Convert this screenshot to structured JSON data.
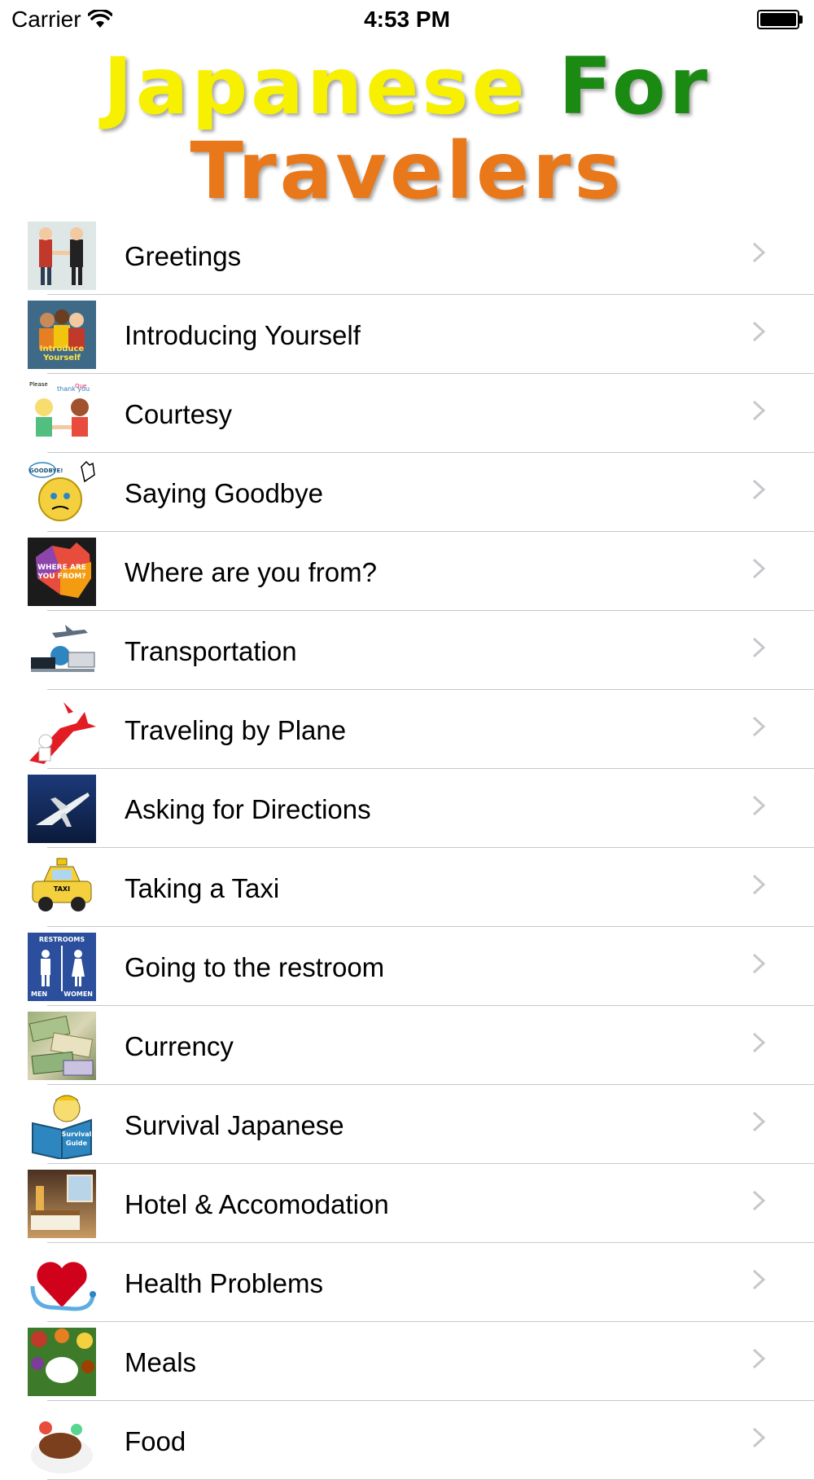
{
  "status_bar": {
    "carrier": "Carrier",
    "time": "4:53 PM",
    "battery_level": 1.0
  },
  "title": {
    "word1": "Japanese",
    "word2": "For",
    "word3": "Travelers",
    "colors": {
      "word1": "#f7f000",
      "word2": "#1a8a12",
      "word3": "#e8781a"
    }
  },
  "list": {
    "items": [
      {
        "label": "Greetings",
        "icon": "handshake-icon"
      },
      {
        "label": "Introducing Yourself",
        "icon": "people-icon",
        "thumb_text": "Introduce Yourself"
      },
      {
        "label": "Courtesy",
        "icon": "speech-bubbles-icon"
      },
      {
        "label": "Saying Goodbye",
        "icon": "waving-emoji-icon",
        "thumb_text": "GOODBYE!"
      },
      {
        "label": "Where are you from?",
        "icon": "map-icon",
        "thumb_text": "WHERE ARE YOU FROM?"
      },
      {
        "label": "Transportation",
        "icon": "transport-icon"
      },
      {
        "label": "Traveling by Plane",
        "icon": "plane-arrow-icon"
      },
      {
        "label": "Asking for Directions",
        "icon": "jet-icon"
      },
      {
        "label": "Taking a Taxi",
        "icon": "taxi-icon",
        "thumb_text": "TAXI"
      },
      {
        "label": "Going to the restroom",
        "icon": "restroom-sign-icon",
        "thumb_text": "RESTROOMS",
        "thumb_text2": "MEN",
        "thumb_text3": "WOMEN"
      },
      {
        "label": "Currency",
        "icon": "banknotes-icon"
      },
      {
        "label": "Survival Japanese",
        "icon": "survival-guide-icon",
        "thumb_text": "Survival Guide"
      },
      {
        "label": "Hotel & Accomodation",
        "icon": "hotel-room-icon"
      },
      {
        "label": "Health Problems",
        "icon": "heart-stethoscope-icon"
      },
      {
        "label": "Meals",
        "icon": "meal-plate-icon"
      },
      {
        "label": "Food",
        "icon": "steak-icon"
      }
    ]
  }
}
